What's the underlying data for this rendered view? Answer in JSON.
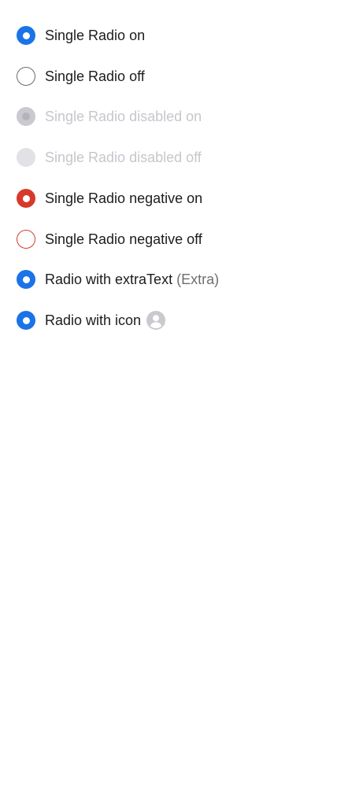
{
  "radios": [
    {
      "label": "Single Radio on",
      "state": "on"
    },
    {
      "label": "Single Radio off",
      "state": "off"
    },
    {
      "label": "Single Radio disabled on",
      "state": "disabled-on"
    },
    {
      "label": "Single Radio disabled off",
      "state": "disabled-off"
    },
    {
      "label": "Single Radio negative on",
      "state": "negative-on"
    },
    {
      "label": "Single Radio negative off",
      "state": "negative-off"
    },
    {
      "label": "Radio with extraText",
      "extra": "(Extra)",
      "state": "on"
    },
    {
      "label": "Radio with icon",
      "icon": "user-avatar-icon",
      "state": "on"
    }
  ],
  "colors": {
    "accent": "#1a73e8",
    "negative": "#d8392b",
    "disabled": "#c9c9cf",
    "text": "#1c1c1e",
    "extra_text": "#6e6e73"
  }
}
